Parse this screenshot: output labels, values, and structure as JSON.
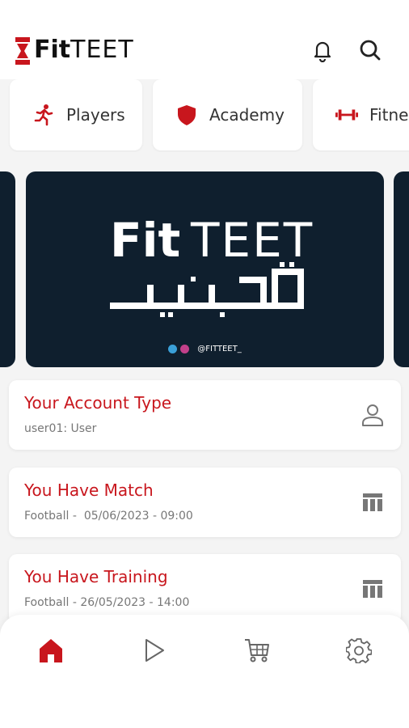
{
  "app": {
    "logo_fit": "Fit",
    "logo_teet": "TEET"
  },
  "header": {
    "bell_icon": "bell-icon",
    "search_icon": "search-icon"
  },
  "categories": [
    {
      "label": "Players",
      "icon": "running-player-icon"
    },
    {
      "label": "Academy",
      "icon": "shield-icon"
    },
    {
      "label": "Fitne",
      "icon": "dumbbell-icon"
    }
  ],
  "banner": {
    "fit": "Fit",
    "teet": "TEET",
    "handle": "@FITTEET_"
  },
  "cards": [
    {
      "title": "Your Account Type",
      "subtitle": "user01: User",
      "icon": "user-icon"
    },
    {
      "title": "You Have Match",
      "subtitle": "Football -  05/06/2023 - 09:00",
      "icon": "calendar-table-icon"
    },
    {
      "title": "You Have Training",
      "subtitle": "Football - 26/05/2023 - 14:00",
      "icon": "calendar-table-icon"
    }
  ],
  "bottom_nav": [
    {
      "name": "home",
      "icon": "home-icon",
      "active": true
    },
    {
      "name": "play",
      "icon": "play-icon",
      "active": false
    },
    {
      "name": "cart",
      "icon": "cart-icon",
      "active": false
    },
    {
      "name": "settings",
      "icon": "gear-icon",
      "active": false
    }
  ],
  "colors": {
    "accent": "#c8161d",
    "banner_bg": "#0f1f2e",
    "page_bg": "#f4f4f4"
  }
}
